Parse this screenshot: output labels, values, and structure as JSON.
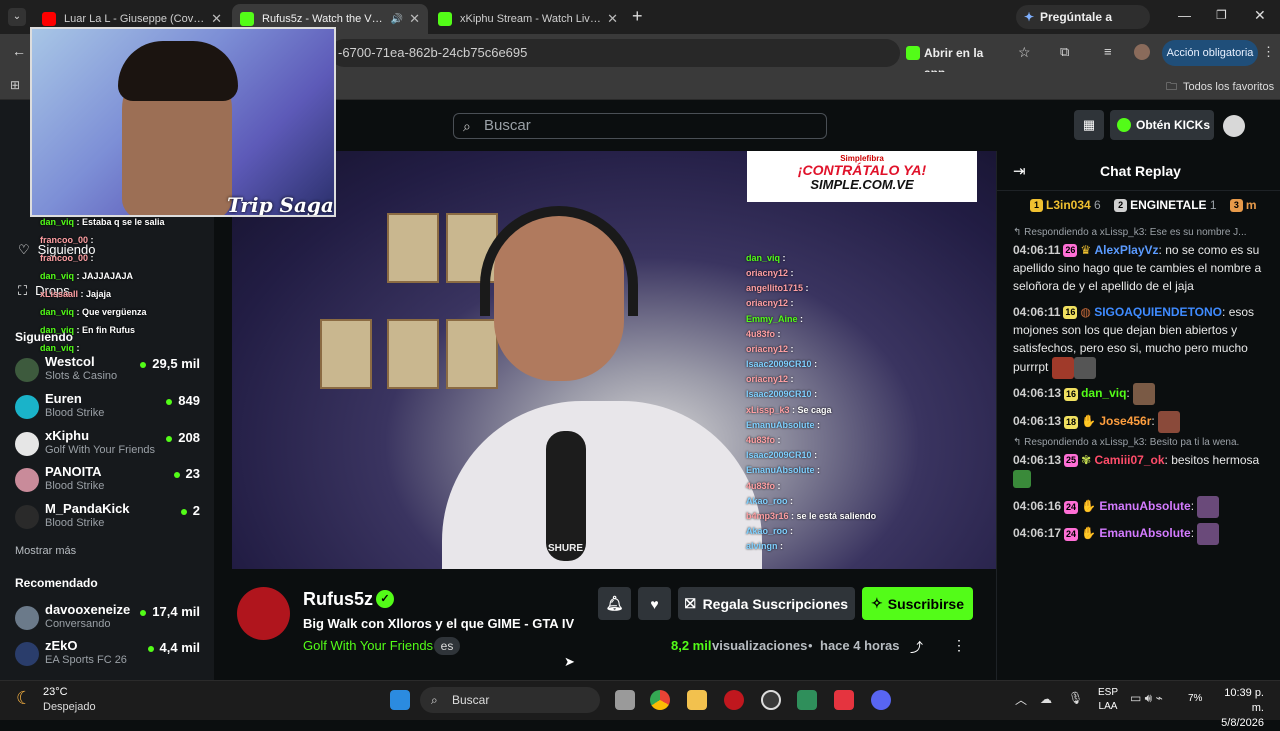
{
  "browser": {
    "tabs": [
      {
        "title": "Luar La L - Giuseppe (Cover Vid",
        "active": false,
        "favicon": "youtube-icon"
      },
      {
        "title": "Rufus5z - Watch the VOD o",
        "active": true,
        "favicon": "kick-icon"
      },
      {
        "title": "xKiphu Stream - Watch Live on",
        "active": false,
        "favicon": "kick-icon"
      }
    ],
    "gemini_label": "Pregúntale a Gemini",
    "url": "-6700-71ea-862b-24cb75c6e695",
    "open_in_app_label": "Abrir en la app",
    "action_required_label": "Acción obligatoria",
    "all_favorites_label": "Todos los favoritos"
  },
  "header": {
    "search_placeholder": "Buscar",
    "get_kicks_label": "Obtén KICKs"
  },
  "sidebar": {
    "nav_following": "Siguiendo",
    "nav_drops": "Drops",
    "following_title": "Siguiendo",
    "following": [
      {
        "name": "Westcol",
        "game": "Slots & Casino",
        "viewers": "29,5 mil",
        "color": "#3d5a3d"
      },
      {
        "name": "Euren",
        "game": "Blood Strike",
        "viewers": "849",
        "color": "#1ab3c9"
      },
      {
        "name": "xKiphu",
        "game": "Golf With Your Friends",
        "viewers": "208",
        "color": "#e6e6e6"
      },
      {
        "name": "PANOITA",
        "game": "Blood Strike",
        "viewers": "23",
        "color": "#c98b9a"
      },
      {
        "name": "M_PandaKick",
        "game": "Blood Strike",
        "viewers": "2",
        "color": "#2a2a2a"
      }
    ],
    "show_more": "Mostrar más",
    "recommended_title": "Recomendado",
    "recommended": [
      {
        "name": "davooxeneize",
        "game": "Conversando",
        "viewers": "17,4 mil",
        "color": "#6b7a8a"
      },
      {
        "name": "zEkO",
        "game": "EA Sports FC 26",
        "viewers": "4,4 mil",
        "color": "#2a3d6b"
      }
    ]
  },
  "overlay": {
    "ad_line1": "Simplefibra",
    "ad_line2": "¡CONTRÁTALO YA!",
    "ad_line3": "SIMPLE.COM.VE",
    "webcam_logo": "Trip Saga",
    "mic_brand": "SHURE",
    "left_chat": [
      {
        "user": "dan_viq",
        "text": "Estaba q se le salia"
      },
      {
        "user": "francoo_00",
        "text": ""
      },
      {
        "user": "francoo_00",
        "text": ""
      },
      {
        "user": "dan_viq",
        "text": "JAJJAJAJA"
      },
      {
        "user": "xLissaall",
        "text": "Jajaja"
      },
      {
        "user": "dan_viq",
        "text": "Que vergüenza"
      },
      {
        "user": "dan_viq",
        "text": "En fin Rufus"
      },
      {
        "user": "dan_viq",
        "text": ""
      }
    ],
    "right_chat": [
      {
        "user": "dan_viq",
        "text": ""
      },
      {
        "user": "oriacny12",
        "text": ""
      },
      {
        "user": "angellito1715",
        "text": ""
      },
      {
        "user": "oriacny12",
        "text": ""
      },
      {
        "user": "Emmy_Aine",
        "text": ""
      },
      {
        "user": "4u83fo",
        "text": ""
      },
      {
        "user": "oriacny12",
        "text": ""
      },
      {
        "user": "Isaac2009CR10",
        "text": ""
      },
      {
        "user": "oriacny12",
        "text": ""
      },
      {
        "user": "Isaac2009CR10",
        "text": ""
      },
      {
        "user": "xLissp_k3",
        "text": "Se caga"
      },
      {
        "user": "EmanuAbsolute",
        "text": ""
      },
      {
        "user": "4u83fo",
        "text": ""
      },
      {
        "user": "Isaac2009CR10",
        "text": ""
      },
      {
        "user": "EmanuAbsolute",
        "text": ""
      },
      {
        "user": "4u83fo",
        "text": ""
      },
      {
        "user": "Akao_roo",
        "text": ""
      },
      {
        "user": "b4mp3r16",
        "text": "se le está saliendo"
      },
      {
        "user": "Akao_roo",
        "text": ""
      },
      {
        "user": "alvingn",
        "text": ""
      }
    ]
  },
  "stream": {
    "channel": "Rufus5z",
    "title": "Big Walk con Xlloros y el que GIME - GTA IV",
    "category": "Golf With Your Friends",
    "language": "es",
    "gift_label": "Regala Suscripciones",
    "subscribe_label": "Suscribirse",
    "views_count": "8,2 mil",
    "views_label": "visualizaciones",
    "time_ago": "hace 4 horas"
  },
  "chat": {
    "title": "Chat Replay",
    "leaders": [
      {
        "rank": "1",
        "name": "L3in034",
        "count": "6"
      },
      {
        "rank": "2",
        "name": "ENGINETALE",
        "count": "1"
      },
      {
        "rank": "3",
        "name": "m",
        "count": ""
      }
    ],
    "messages": [
      {
        "reply": "Respondiendo a xLissp_k3: Ese es su nombre J...",
        "time": "04:06:11",
        "badge": "26",
        "user": "AlexPlayVz",
        "color": "#5b9bff",
        "text": "no se como es su apellido sino hago que te cambies el nombre a seloñora de y el apellido de el jaja"
      },
      {
        "reply": "",
        "time": "04:06:11",
        "badge": "16",
        "user": "SIGOAQUIENDETONO",
        "color": "#3f8bff",
        "text": "esos mojones son los que dejan bien abiertos y satisfechos, pero eso si, mucho pero mucho purrrpt"
      },
      {
        "reply": "",
        "time": "04:06:13",
        "badge": "16",
        "user": "dan_viq",
        "color": "#53fc18",
        "text": ""
      },
      {
        "reply": "",
        "time": "04:06:13",
        "badge": "18",
        "user": "Jose456r",
        "color": "#ff9f3f",
        "text": ""
      },
      {
        "reply": "Respondiendo a xLissp_k3: Besito pa ti la wena.",
        "time": "04:06:13",
        "badge": "25",
        "user": "Camiii07_ok",
        "color": "#ff4d6a",
        "text": "besitos hermosa"
      },
      {
        "reply": "",
        "time": "04:06:16",
        "badge": "24",
        "user": "EmanuAbsolute",
        "color": "#d47bff",
        "text": ""
      },
      {
        "reply": "",
        "time": "04:06:17",
        "badge": "24",
        "user": "EmanuAbsolute",
        "color": "#d47bff",
        "text": ""
      }
    ]
  },
  "taskbar": {
    "weather_temp": "23°C",
    "weather_desc": "Despejado",
    "search_label": "Buscar",
    "lang1": "ESP",
    "lang2": "LAA",
    "battery": "7%",
    "time": "10:39 p. m.",
    "date": "5/8/2026"
  }
}
